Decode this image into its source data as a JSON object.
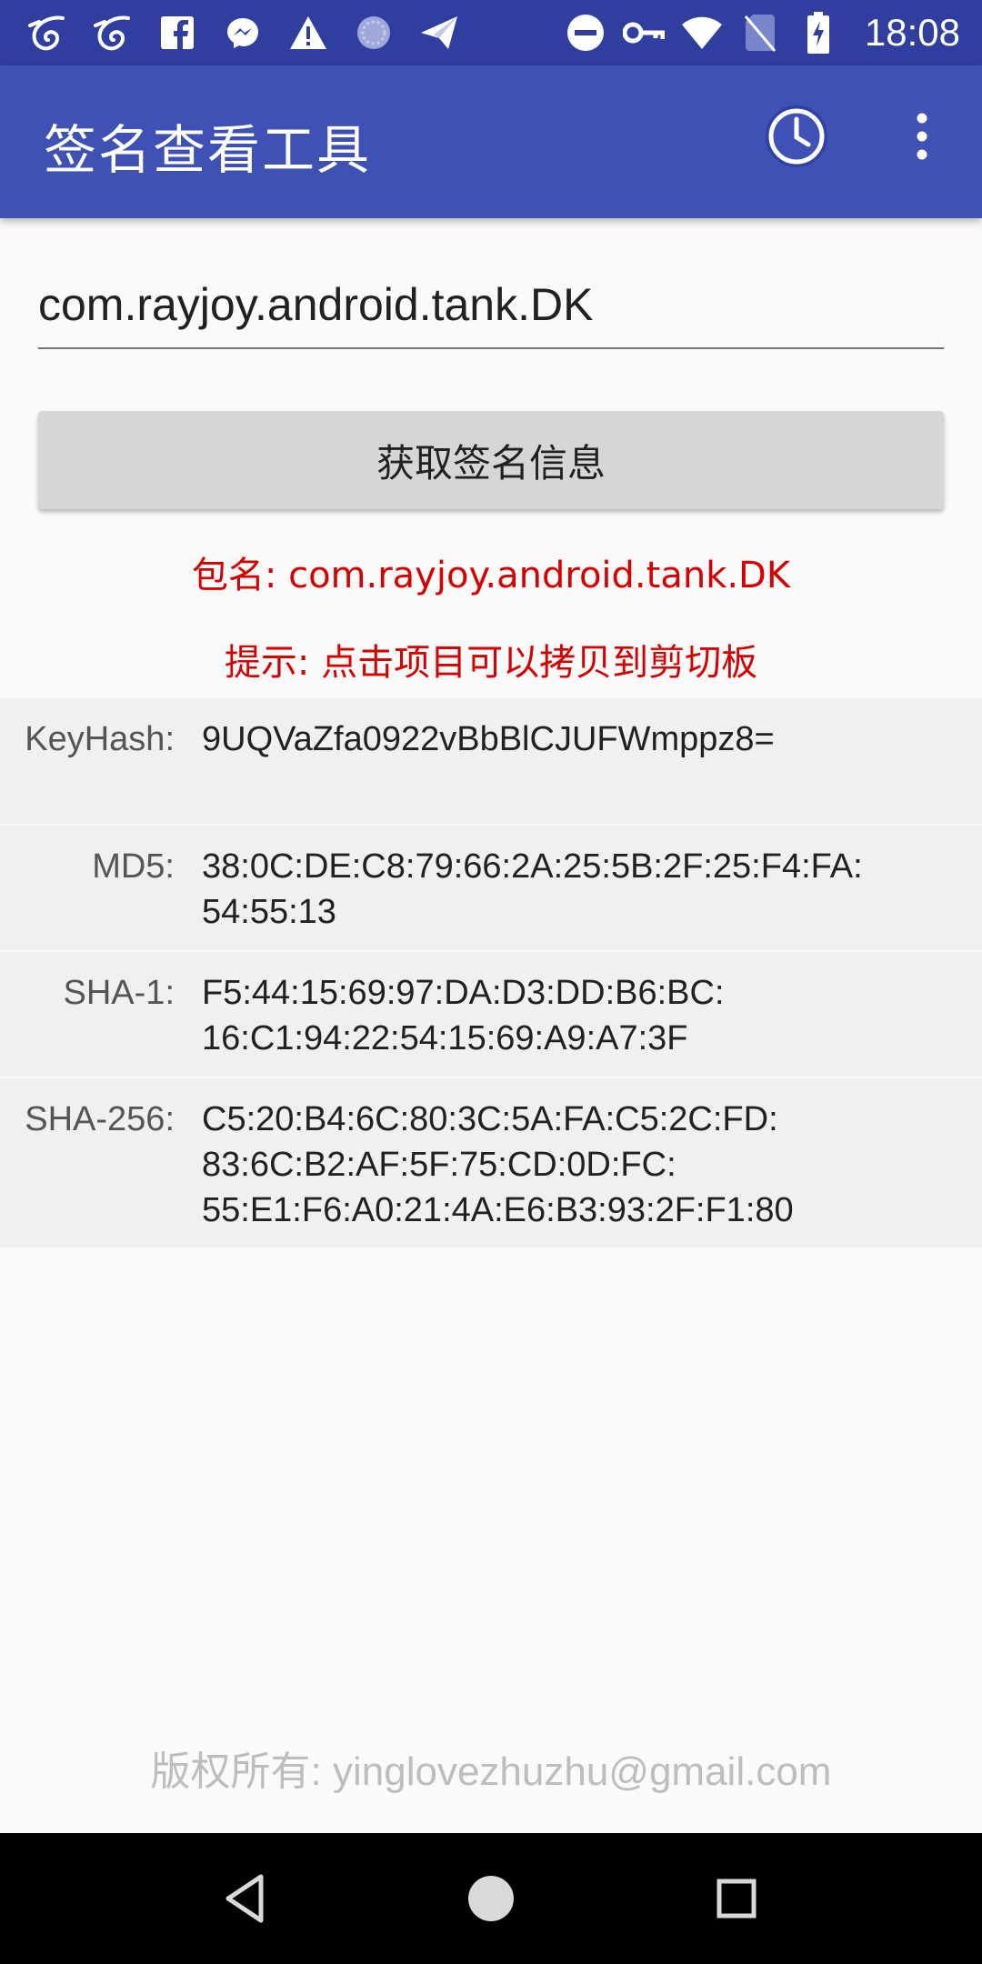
{
  "status_bar": {
    "time": "18:08",
    "left_icons": [
      "bird-app-icon",
      "bird-app-icon",
      "facebook-icon",
      "messenger-icon",
      "warning-icon",
      "sync-spinner-icon",
      "send-icon"
    ],
    "right_icons": [
      "do-not-disturb-icon",
      "key-icon",
      "wifi-icon",
      "no-sim-icon",
      "battery-charging-icon"
    ]
  },
  "app_bar": {
    "title": "签名查看工具",
    "actions": [
      "history-icon",
      "more-vert-icon"
    ]
  },
  "form": {
    "package_value": "com.rayjoy.android.tank.DK",
    "button_label": "获取签名信息"
  },
  "info": {
    "package_line": "包名: com.rayjoy.android.tank.DK",
    "tip_line": "提示: 点击项目可以拷贝到剪切板"
  },
  "signatures": [
    {
      "label": "KeyHash:",
      "value": "9UQVaZfa0922vBbBlCJUFWmppz8="
    },
    {
      "label": "MD5:",
      "value": "38:0C:DE:C8:79:66:2A:25:5B:2F:25:F4:FA:\n54:55:13"
    },
    {
      "label": "SHA-1:",
      "value": "F5:44:15:69:97:DA:D3:DD:B6:BC:\n16:C1:94:22:54:15:69:A9:A7:3F"
    },
    {
      "label": "SHA-256:",
      "value": "C5:20:B4:6C:80:3C:5A:FA:C5:2C:FD:\n83:6C:B2:AF:5F:75:CD:0D:FC:\n55:E1:F6:A0:21:4A:E6:B3:93:2F:F1:80"
    }
  ],
  "footer": {
    "copyright": "版权所有: yinglovezhuzhu@gmail.com"
  },
  "colors": {
    "status_bar": "#303f9f",
    "app_bar": "#3f51b5",
    "accent_text": "#d50000"
  }
}
